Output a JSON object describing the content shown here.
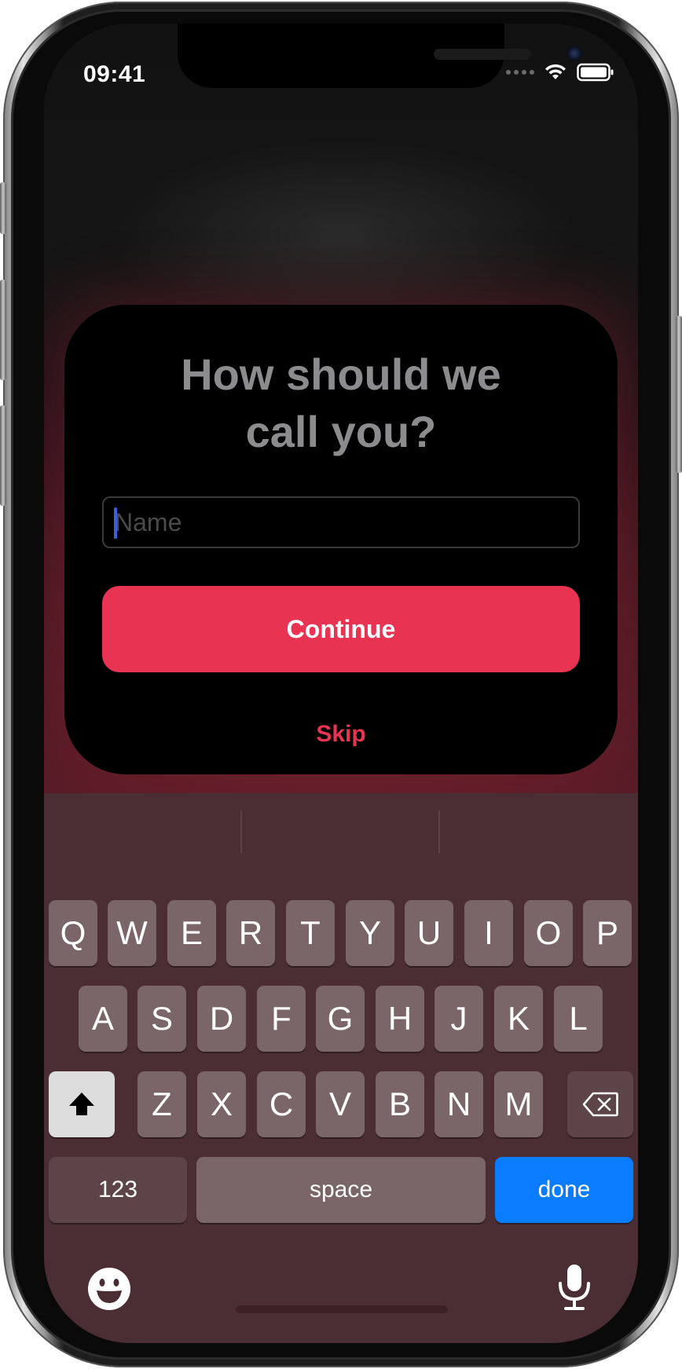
{
  "status_bar": {
    "time": "09:41",
    "icons": [
      "signal-dots-icon",
      "wifi-icon",
      "battery-icon"
    ]
  },
  "prompt_card": {
    "title": "How should we call you?",
    "name_input": {
      "placeholder": "Name",
      "value": ""
    },
    "continue_label": "Continue",
    "skip_label": "Skip"
  },
  "keyboard": {
    "row1": [
      "Q",
      "W",
      "E",
      "R",
      "T",
      "Y",
      "U",
      "I",
      "O",
      "P"
    ],
    "row2": [
      "A",
      "S",
      "D",
      "F",
      "G",
      "H",
      "J",
      "K",
      "L"
    ],
    "row3": [
      "Z",
      "X",
      "C",
      "V",
      "B",
      "N",
      "M"
    ],
    "numbers_label": "123",
    "space_label": "space",
    "done_label": "done",
    "icons": [
      "shift-icon",
      "backspace-icon",
      "emoji-icon",
      "microphone-icon"
    ]
  },
  "colors": {
    "accent": "#e83352",
    "done_key": "#0a7cff",
    "keyboard_bg": "#4a2e33",
    "key_bg": "#7a6569",
    "title_text": "#8c8c8e"
  }
}
